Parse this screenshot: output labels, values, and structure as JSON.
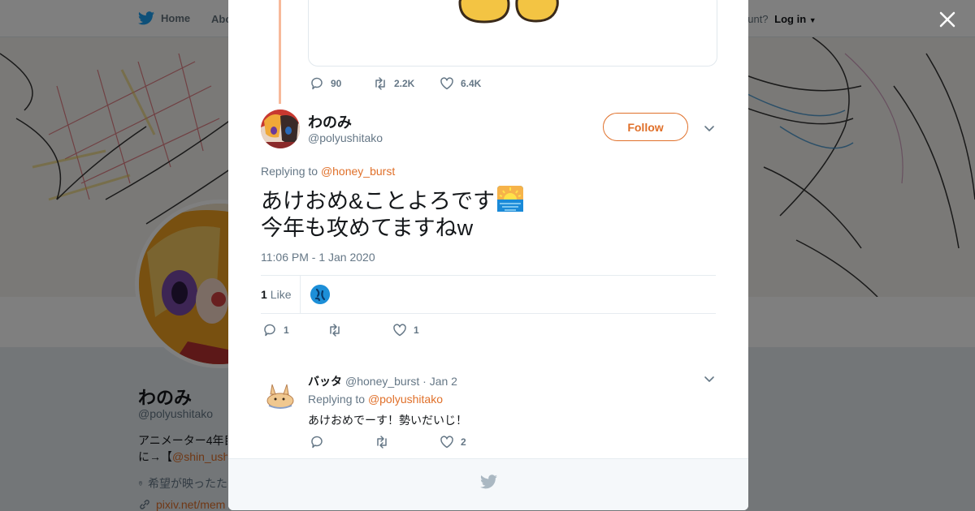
{
  "nav": {
    "home_label": "Home",
    "about_label": "Abo",
    "account_prompt": "ccount?",
    "login_label": "Log in"
  },
  "profile": {
    "name": "わのみ",
    "handle": "@polyushitako",
    "bio_line1": "アニメーター4年目",
    "bio_line2_prefix": "に→【",
    "bio_line2_link": "@shin_ush",
    "location": "希望が映ったた",
    "url": "pixiv.net/mem"
  },
  "thread": {
    "prev_tweet_stats": {
      "replies": "90",
      "retweets": "2.2K",
      "likes": "6.4K"
    }
  },
  "main_tweet": {
    "author_name": "わのみ",
    "author_handle": "@polyushitako",
    "follow_label": "Follow",
    "replying_prefix": "Replying to",
    "replying_to": "@honey_burst",
    "text_line1": "あけおめ&ことよろです",
    "text_line2": "今年も攻めてますねw",
    "timestamp": "11:06 PM - 1 Jan 2020",
    "likes_count": "1",
    "likes_label": "Like",
    "stats": {
      "replies": "1",
      "retweets": "",
      "likes": "1"
    }
  },
  "reply": {
    "author_name": "バッタ",
    "author_handle": "@honey_burst",
    "date": "· Jan 2",
    "replying_prefix": "Replying to",
    "replying_to": "@polyushitako",
    "text": "あけおめでーす！勢いだいじ！",
    "stats": {
      "replies": "",
      "retweets": "",
      "likes": "2"
    }
  },
  "colors": {
    "accent": "#e0702a",
    "thread_line": "#f7b99a",
    "icon_gray": "#657786",
    "twitter_blue": "#1da1f2"
  }
}
